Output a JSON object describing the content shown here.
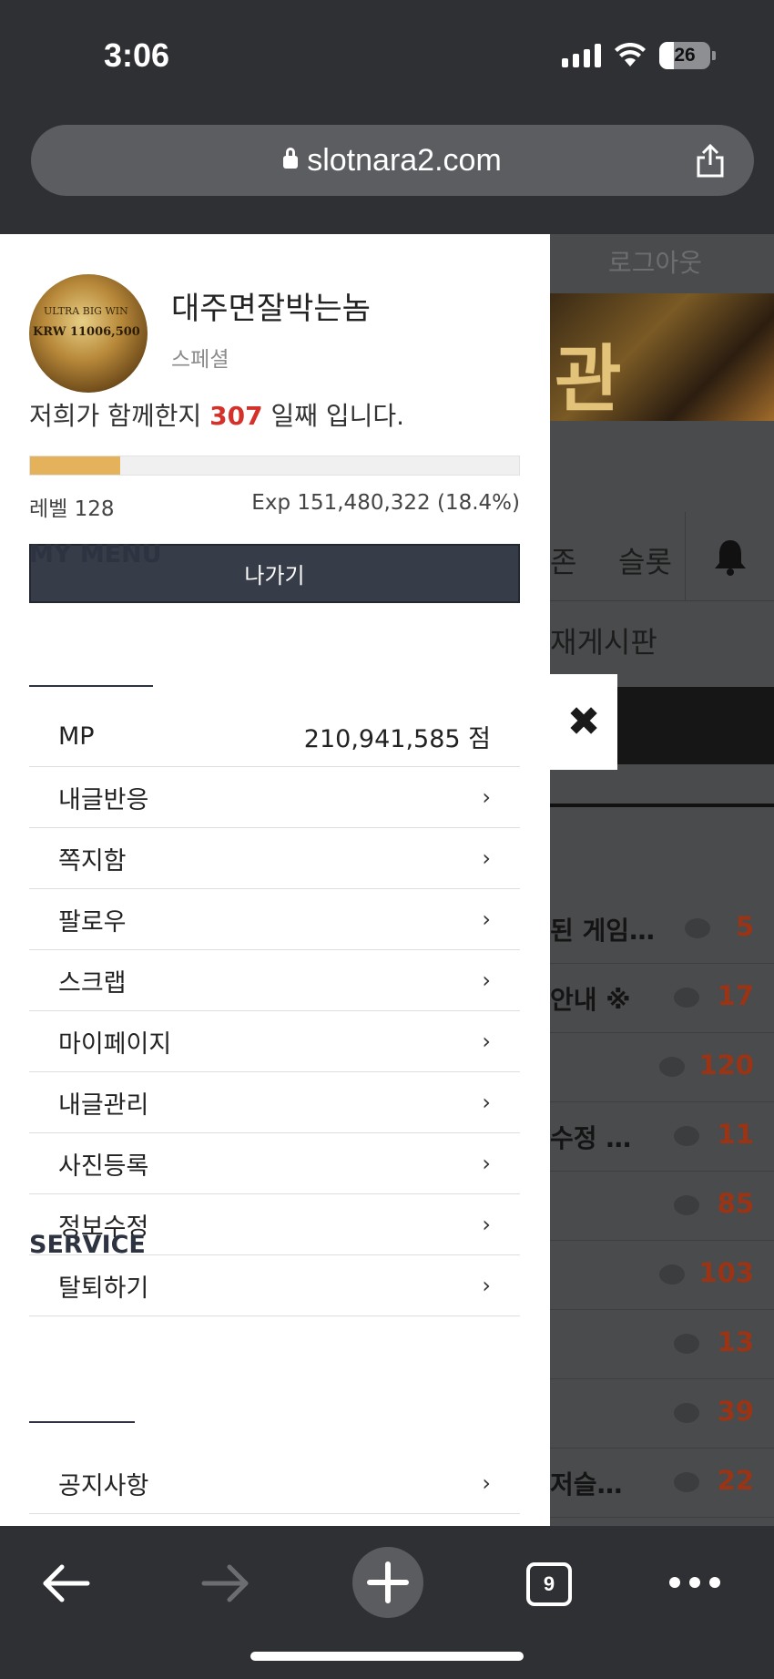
{
  "status": {
    "time": "3:06",
    "battery": "26"
  },
  "browser": {
    "url": "slotnara2.com",
    "tab_count": "9"
  },
  "background_site": {
    "logout_label": "로그아웃",
    "banner_char": "관",
    "nav_partial_1": "존",
    "nav_partial_2": "슬롯",
    "board_title": "재게시판",
    "rows": [
      {
        "title": "된 게임…",
        "count": "5"
      },
      {
        "title": "안내 ※",
        "count": "17"
      },
      {
        "title": "",
        "count": "120"
      },
      {
        "title": "수정 …",
        "count": "11"
      },
      {
        "title": "",
        "count": "85"
      },
      {
        "title": "",
        "count": "103"
      },
      {
        "title": "",
        "count": "13"
      },
      {
        "title": "",
        "count": "39"
      },
      {
        "title": "저슬…",
        "count": "22"
      }
    ]
  },
  "profile": {
    "avatar_text_1": "ULTRA BIG WIN",
    "avatar_text_2": "KRW 11006,500",
    "nickname": "대주면잘박는놈",
    "grade": "스페셜",
    "days_prefix": "저희가 함께한지 ",
    "days_count": "307",
    "days_suffix": " 일째 입니다.",
    "exp_progress": 0.184,
    "level": "레벨 128",
    "exp": "Exp 151,480,322 (18.4%)",
    "logout_button": "나가기"
  },
  "my_menu": {
    "title": "MY MENU",
    "mp_label": "MP",
    "mp_value": "210,941,585 점",
    "items": [
      "내글반응",
      "쪽지함",
      "팔로우",
      "스크랩",
      "마이페이지",
      "내글관리",
      "사진등록",
      "정보수정",
      "탈퇴하기"
    ]
  },
  "service": {
    "title": "SERVICE",
    "items": [
      "공지사항"
    ]
  },
  "close_glyph": "✖",
  "chevron": "›"
}
